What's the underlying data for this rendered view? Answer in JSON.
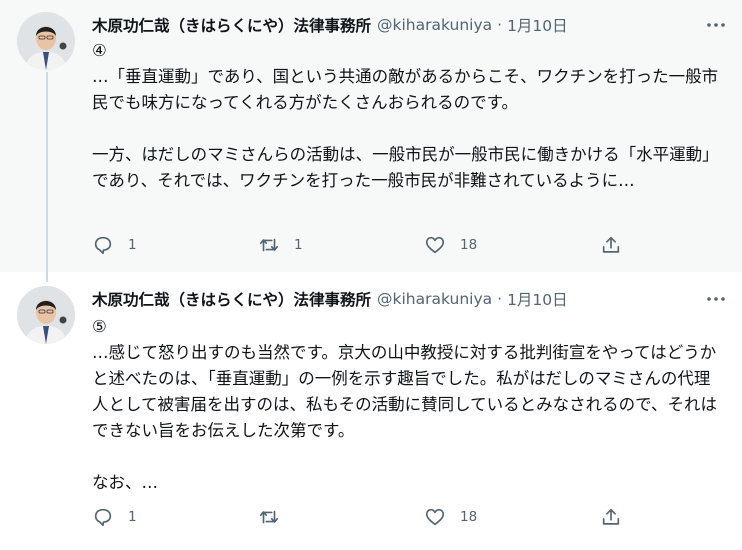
{
  "tweets": [
    {
      "author_name": "木原功仁哉（きはらくにや）法律事務所",
      "handle": "@kiharakuniya",
      "separator": "·",
      "time": "1月10日",
      "text": "④\n…「垂直運動」であり、国という共通の敵があるからこそ、ワクチンを打った一般市民でも味方になってくれる方がたくさんおられるのです。\n\n一方、はだしのマミさんらの活動は、一般市民が一般市民に働きかける「水平運動」であり、それでは、ワクチンを打った一般市民が非難されているように…",
      "reply_count": "1",
      "retweet_count": "1",
      "like_count": "18",
      "icons": {
        "more": "more-icon",
        "reply": "reply-icon",
        "retweet": "retweet-icon",
        "like": "heart-icon",
        "share": "share-icon"
      }
    },
    {
      "author_name": "木原功仁哉（きはらくにや）法律事務所",
      "handle": "@kiharakuniya",
      "separator": "·",
      "time": "1月10日",
      "text": "⑤\n…感じて怒り出すのも当然です。京大の山中教授に対する批判街宣をやってはどうかと述べたのは、「垂直運動」の一例を示す趣旨でした。私がはだしのマミさんの代理人として被害届を出すのは、私もその活動に賛同しているとみなされるので、それはできない旨をお伝えした次第です。\n\nなお、…",
      "reply_count": "1",
      "retweet_count": "",
      "like_count": "18",
      "icons": {
        "more": "more-icon",
        "reply": "reply-icon",
        "retweet": "retweet-icon",
        "like": "heart-icon",
        "share": "share-icon"
      }
    }
  ],
  "colors": {
    "highlight_bg": "#f7f9f9",
    "thread_line": "#cfd9de",
    "secondary_text": "#536471",
    "primary_text": "#0f1419"
  }
}
